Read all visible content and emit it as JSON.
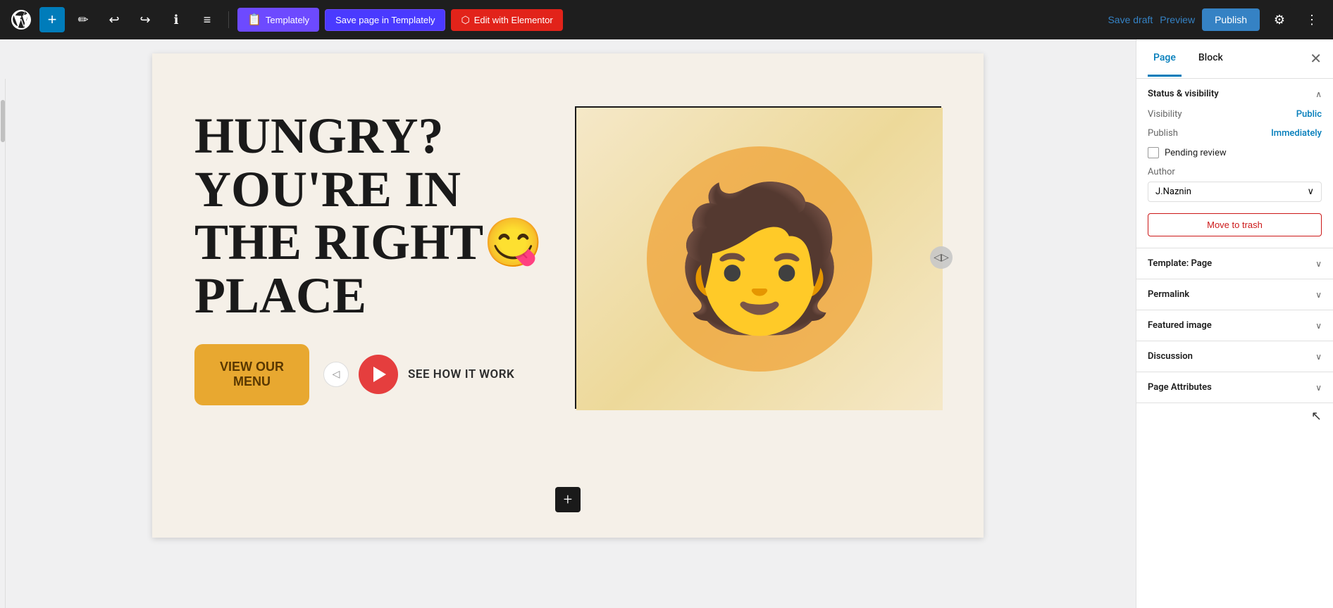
{
  "toolbar": {
    "add_label": "+",
    "save_draft_label": "Save draft",
    "preview_label": "Preview",
    "publish_label": "Publish",
    "templately_label": "Templately",
    "save_templately_label": "Save page in Templately",
    "elementor_label": "Edit with Elementor"
  },
  "sidebar": {
    "tab_page": "Page",
    "tab_block": "Block",
    "status_visibility": {
      "title": "Status & visibility",
      "visibility_label": "Visibility",
      "visibility_value": "Public",
      "publish_label": "Publish",
      "publish_value": "Immediately",
      "pending_label": "Pending review",
      "author_label": "Author",
      "author_value": "J.Naznin"
    },
    "move_to_trash": "Move to trash",
    "template_section": {
      "title": "Template: Page"
    },
    "permalink_section": {
      "title": "Permalink"
    },
    "featured_image_section": {
      "title": "Featured image"
    },
    "discussion_section": {
      "title": "Discussion"
    },
    "page_attributes_section": {
      "title": "Page Attributes"
    }
  },
  "canvas": {
    "hero": {
      "heading_line1": "HUNGRY?",
      "heading_line2": "YOU'RE IN",
      "heading_line3": "THE RIGHT",
      "heading_emoji": "😋",
      "heading_line4": "PLACE",
      "view_menu_label": "VIEW OUR\nMENU",
      "see_how_label": "SEE HOW IT WORK"
    },
    "add_block_label": "+"
  }
}
